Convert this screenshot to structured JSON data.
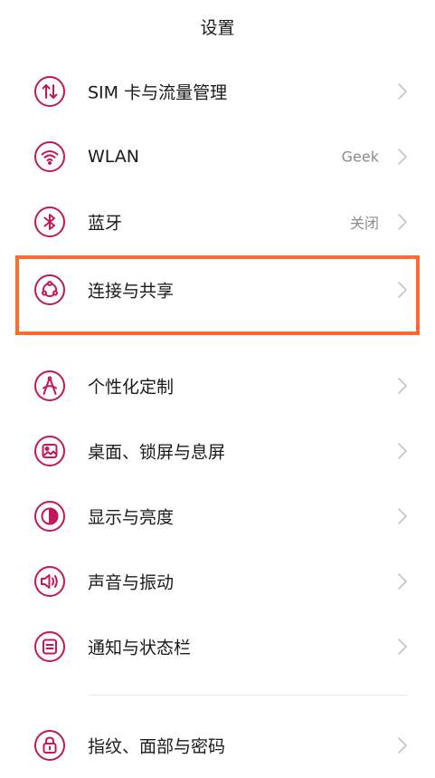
{
  "header": {
    "title": "设置"
  },
  "accent_color": "#c2185b",
  "highlight_color": "#ff6a33",
  "settings": {
    "items": [
      {
        "label": "SIM 卡与流量管理",
        "value": "",
        "icon": "sim-data-icon"
      },
      {
        "label": "WLAN",
        "value": "Geek",
        "icon": "wifi-icon"
      },
      {
        "label": "蓝牙",
        "value": "关闭",
        "icon": "bluetooth-icon"
      },
      {
        "label": "连接与共享",
        "value": "",
        "icon": "connection-share-icon"
      },
      {
        "label": "个性化定制",
        "value": "",
        "icon": "personalization-icon"
      },
      {
        "label": "桌面、锁屏与息屏",
        "value": "",
        "icon": "wallpaper-icon"
      },
      {
        "label": "显示与亮度",
        "value": "",
        "icon": "brightness-icon"
      },
      {
        "label": "声音与振动",
        "value": "",
        "icon": "sound-icon"
      },
      {
        "label": "通知与状态栏",
        "value": "",
        "icon": "notification-icon"
      },
      {
        "label": "指纹、面部与密码",
        "value": "",
        "icon": "lock-icon"
      }
    ]
  }
}
